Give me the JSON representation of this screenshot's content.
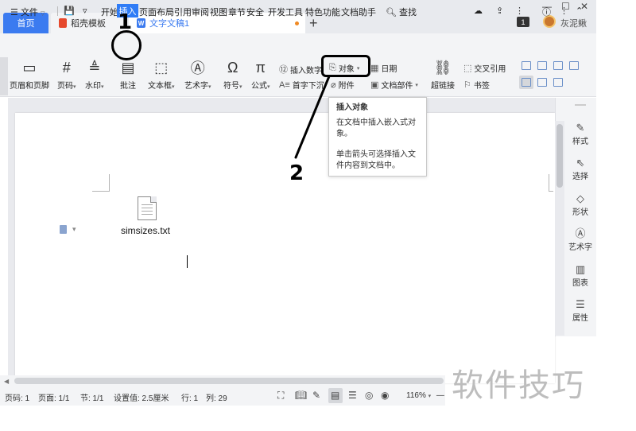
{
  "tabs": {
    "home": "首页",
    "template": "稻壳模板",
    "document": "文字文稿1",
    "add": "+"
  },
  "titlebar": {
    "badge": "1",
    "username": "灰泥鳅",
    "minimize": "—",
    "maximize": "☐",
    "close": "✕"
  },
  "menu": {
    "file": "文件",
    "start": "开始",
    "insert": "插入",
    "page_layout": "页面布局",
    "references": "引用",
    "review": "审阅",
    "view": "视图",
    "chapter": "章节",
    "security": "安全",
    "developer": "开发工具",
    "features": "特色功能",
    "doc_assistant": "文档助手",
    "search": "查找"
  },
  "ribbon": {
    "header_footer": "页眉和页脚",
    "page_number": "页码",
    "watermark": "水印",
    "comment": "批注",
    "textbox": "文本框",
    "wordart": "艺术字",
    "symbol": "符号",
    "formula": "公式",
    "insert_number": "插入数字",
    "dropcap": "首字下沉",
    "object": "对象",
    "attachment": "附件",
    "date": "日期",
    "doc_parts": "文档部件",
    "hyperlink": "超链接",
    "cross_ref": "交叉引用",
    "bookmark": "书签"
  },
  "tooltip": {
    "title": "插入对象",
    "desc": "在文档中插入嵌入式对象。",
    "hint": "单击箭头可选择插入文件内容到文档中。"
  },
  "document": {
    "embedded_file": "simsizes.txt"
  },
  "right_panel": {
    "style": "样式",
    "select": "选择",
    "shape": "形状",
    "wordart": "艺术字",
    "chart": "图表",
    "properties": "属性"
  },
  "status": {
    "page_num": "页码: 1",
    "page": "页面: 1/1",
    "section": "节: 1/1",
    "setting": "设置值: 2.5厘米",
    "row": "行: 1",
    "col": "列: 29",
    "zoom": "116%"
  },
  "annotations": {
    "step1": "1",
    "step2": "2"
  },
  "watermark": "软件技巧",
  "colors": {
    "accent": "#3b7bf0",
    "insert_tab": "#2f7cf6",
    "template_logo": "#e6492d"
  }
}
